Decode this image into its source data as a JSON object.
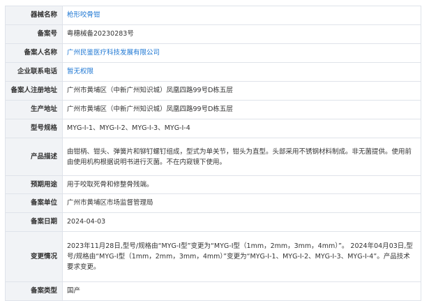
{
  "rows": [
    {
      "label": "器械名称",
      "value": "枪形咬骨钳"
    },
    {
      "label": "备案号",
      "value": "粤穗械备20230283号"
    },
    {
      "label": "备案人名称",
      "value": "广州民鉴医疗科技发展有限公司"
    },
    {
      "label": "企业联系电话",
      "value": "暂无权限"
    },
    {
      "label": "备案人注册地址",
      "value": "广州市黄埔区（中新广州知识城）凤凰四路99号D栋五层"
    },
    {
      "label": "生产地址",
      "value": "广州市黄埔区（中新广州知识城）凤凰四路99号D栋五层"
    },
    {
      "label": "型号规格",
      "value": "MYG-I-1、MYG-I-2、MYG-I-3、MYG-I-4"
    },
    {
      "label": "产品描述",
      "value": "由钳柄、钳头、弹簧片和铆钉螺钉组成，型式为单关节，钳头为直型。头部采用不锈钢材料制成。非无菌提供。使用前由使用机构根据说明书进行灭菌。不在内窥镜下使用。"
    },
    {
      "label": "预期用途",
      "value": "用于咬取死骨和修整骨残端。"
    },
    {
      "label": "备案单位",
      "value": "广州市黄埔区市场监督管理局"
    },
    {
      "label": "备案日期",
      "value": "2024-04-03"
    },
    {
      "label": "变更情况",
      "value": "2023年11月28日,型号/规格由“MYG-I型”变更为“MYG-I型（1mm，2mm，3mm，4mm）”。 2024年04月03日,型号/规格由“MYG-I型（1mm，2mm，3mm，4mm）”变更为“MYG-I-1、MYG-I-2、MYG-I-3、MYG-I-4”。产品技术要求变更。"
    },
    {
      "label": "备案类型",
      "value": "国产"
    }
  ]
}
